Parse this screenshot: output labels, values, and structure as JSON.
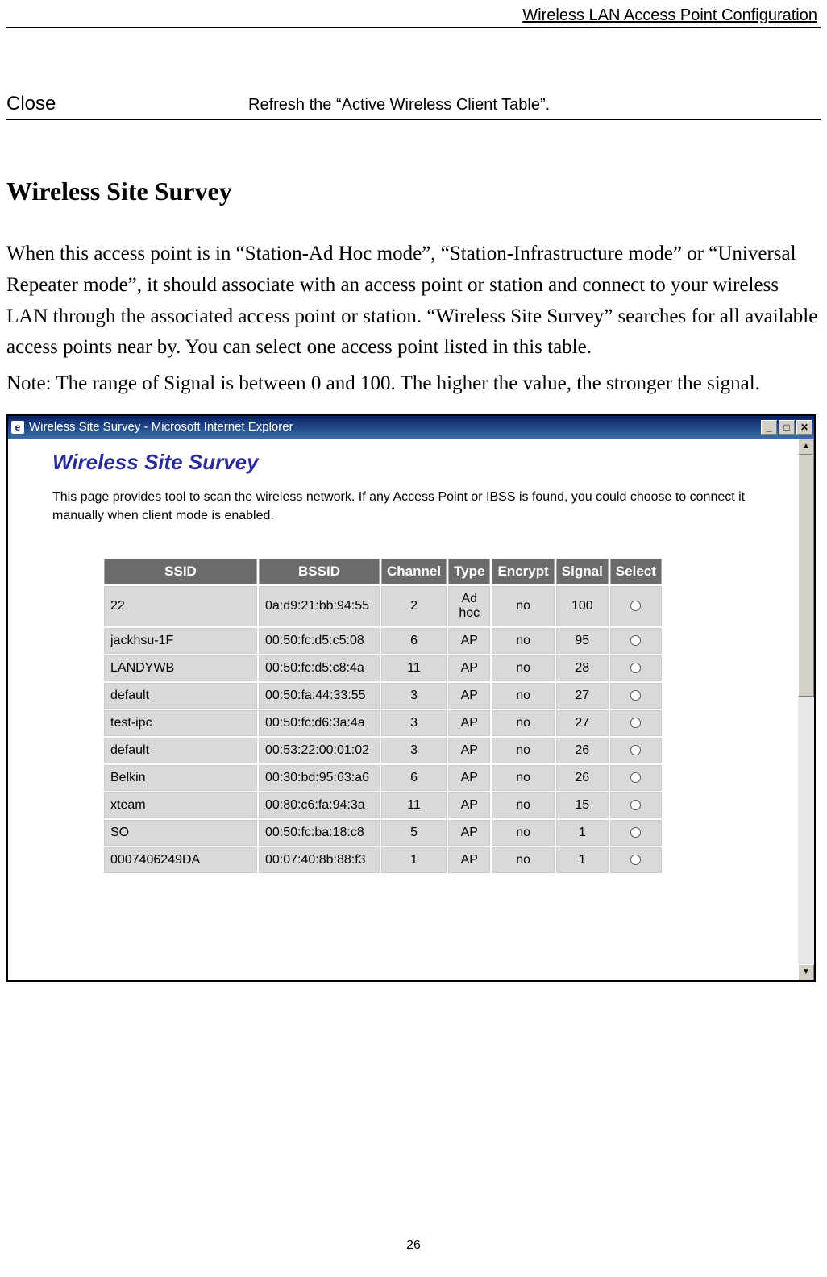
{
  "header": {
    "running_title": "Wireless LAN Access Point Configuration"
  },
  "definition": {
    "term": "Close",
    "desc": "Refresh the “Active Wireless Client Table”."
  },
  "section": {
    "title": "Wireless Site Survey",
    "para1": "When this access point is in “Station-Ad Hoc mode”, “Station-Infrastructure mode” or “Universal Repeater mode”, it should associate with an access point or station and connect to your wireless LAN through the associated access point or station. “Wireless Site Survey” searches for all available access points near by. You can select one access point listed in this table.",
    "para2": "Note: The range of Signal is between 0 and 100. The higher the value, the stronger the signal."
  },
  "window": {
    "title": "Wireless Site Survey - Microsoft Internet Explorer",
    "ie_glyph": "e",
    "min": "_",
    "max": "□",
    "close": "✕",
    "scroll_up": "▲",
    "scroll_down": "▼"
  },
  "panel": {
    "title": "Wireless Site Survey",
    "desc": "This page provides tool to scan the wireless network. If any Access Point or IBSS is found, you could choose to connect it manually when client mode is enabled."
  },
  "table": {
    "headers": {
      "ssid": "SSID",
      "bssid": "BSSID",
      "channel": "Channel",
      "type": "Type",
      "encrypt": "Encrypt",
      "signal": "Signal",
      "select": "Select"
    },
    "rows": [
      {
        "ssid": "22",
        "bssid": "0a:d9:21:bb:94:55",
        "channel": "2",
        "type": "Ad hoc",
        "encrypt": "no",
        "signal": "100"
      },
      {
        "ssid": "jackhsu-1F",
        "bssid": "00:50:fc:d5:c5:08",
        "channel": "6",
        "type": "AP",
        "encrypt": "no",
        "signal": "95"
      },
      {
        "ssid": "LANDYWB",
        "bssid": "00:50:fc:d5:c8:4a",
        "channel": "11",
        "type": "AP",
        "encrypt": "no",
        "signal": "28"
      },
      {
        "ssid": "default",
        "bssid": "00:50:fa:44:33:55",
        "channel": "3",
        "type": "AP",
        "encrypt": "no",
        "signal": "27"
      },
      {
        "ssid": "test-ipc",
        "bssid": "00:50:fc:d6:3a:4a",
        "channel": "3",
        "type": "AP",
        "encrypt": "no",
        "signal": "27"
      },
      {
        "ssid": "default",
        "bssid": "00:53:22:00:01:02",
        "channel": "3",
        "type": "AP",
        "encrypt": "no",
        "signal": "26"
      },
      {
        "ssid": "Belkin",
        "bssid": "00:30:bd:95:63:a6",
        "channel": "6",
        "type": "AP",
        "encrypt": "no",
        "signal": "26"
      },
      {
        "ssid": "xteam",
        "bssid": "00:80:c6:fa:94:3a",
        "channel": "11",
        "type": "AP",
        "encrypt": "no",
        "signal": "15"
      },
      {
        "ssid": "SO",
        "bssid": "00:50:fc:ba:18:c8",
        "channel": "5",
        "type": "AP",
        "encrypt": "no",
        "signal": "1"
      },
      {
        "ssid": "0007406249DA",
        "bssid": "00:07:40:8b:88:f3",
        "channel": "1",
        "type": "AP",
        "encrypt": "no",
        "signal": "1"
      }
    ]
  },
  "footer": {
    "page_number": "26"
  }
}
